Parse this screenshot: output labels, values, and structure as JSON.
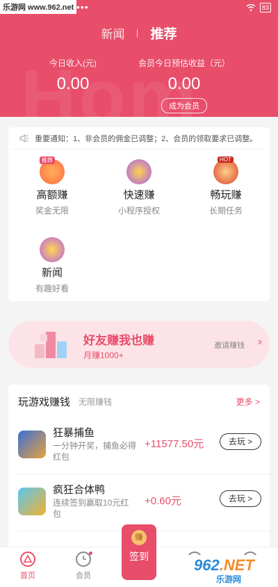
{
  "status_bar": {
    "watermark": "乐游网 www.962.net",
    "dots": "•••",
    "battery": "83"
  },
  "header": {
    "bg_word": "Hom",
    "tabs": [
      {
        "label": "新闻"
      },
      {
        "label": "推荐"
      }
    ],
    "today_income_label": "今日收入(元)",
    "today_income_value": "0.00",
    "member_estimate_label": "会员今日预估收益（元）",
    "member_estimate_value": "0.00",
    "become_member_label": "成为会员"
  },
  "notice": {
    "text": "重要通知：1、非会员的佣金已调整；2、会员的领取要求已调整。"
  },
  "features": [
    {
      "title": "高额赚",
      "subtitle": "奖金无限",
      "tag": "推荐"
    },
    {
      "title": "快速赚",
      "subtitle": "小程序授权"
    },
    {
      "title": "畅玩赚",
      "subtitle": "长期任务",
      "tag": "HOT"
    },
    {
      "title": "新闻",
      "subtitle": "有趣好看"
    }
  ],
  "banner": {
    "title": "好友赚我也赚",
    "subtitle": "月赚1000+",
    "invite_label": "邀请赚钱"
  },
  "games_section": {
    "title": "玩游戏赚钱",
    "subtitle": "无限赚钱",
    "more_label": "更多 >",
    "games": [
      {
        "name": "狂暴捕鱼",
        "desc": "一分钟开奖，捕鱼必得红包",
        "reward": "+11577.50元",
        "button": "去玩 >"
      },
      {
        "name": "疯狂合体鸭",
        "desc": "连续签到赢取10元红包",
        "reward": "+0.60元",
        "button": "去玩 >"
      }
    ]
  },
  "tabbar": {
    "home_label": "首页",
    "member_label": "会员",
    "sign_label": "签到",
    "sign_coin": "赚"
  },
  "watermark": {
    "brand": "962",
    "domain": ".NET",
    "site": "乐游网"
  },
  "colors": {
    "primary": "#e84d6a",
    "banner_bg": "#fbe3e7"
  }
}
